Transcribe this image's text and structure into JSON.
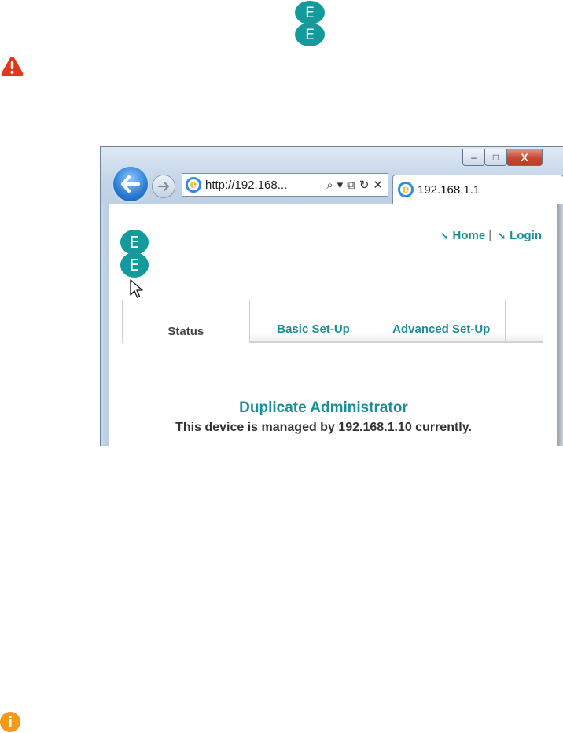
{
  "header_logo": {
    "letters": [
      "E",
      "E"
    ]
  },
  "colors": {
    "brand": "#159a9c",
    "warning": "#e0381c",
    "info": "#f39a1a",
    "link": "#1a8f96"
  },
  "icons": {
    "warning": "warning-icon",
    "info": "info-icon",
    "back": "back-arrow-icon",
    "forward": "forward-arrow-icon"
  },
  "browser": {
    "window_buttons": {
      "minimize": "–",
      "maximize": "□",
      "close": "X"
    },
    "address": "http://192.168...",
    "address_tools": {
      "search": "⌕",
      "dropdown": "▾",
      "compat": "⧉",
      "refresh": "↻",
      "stop": "✕"
    },
    "tab_title": "192.168.1.1",
    "ie_glyph": "e"
  },
  "page": {
    "logo_letters": [
      "E",
      "E"
    ],
    "links": {
      "home": "Home",
      "separator": "|",
      "login": "Login",
      "arrow": "➘"
    },
    "tabs": [
      "Status",
      "Basic Set-Up",
      "Advanced Set-Up"
    ],
    "heading": "Duplicate Administrator",
    "message": "This device is managed by 192.168.1.10 currently."
  },
  "info_glyph": "i"
}
